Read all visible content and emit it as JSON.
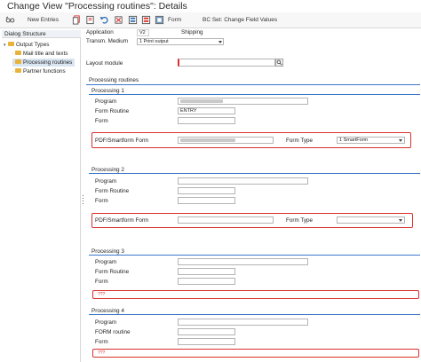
{
  "window": {
    "title": "Change View \"Processing routines\": Details"
  },
  "toolbar": {
    "new_entries": "New Entries",
    "form": "Form",
    "bc_set": "BC Set: Change Field Values"
  },
  "dialog_structure": {
    "title": "Dialog Structure",
    "items": [
      {
        "label": "Output Types"
      },
      {
        "label": "Mail title and texts"
      },
      {
        "label": "Processing routines"
      },
      {
        "label": "Partner functions"
      }
    ]
  },
  "header": {
    "application_label": "Application",
    "application_value": "V2",
    "application_desc": "Shipping",
    "medium_label": "Transm. Medium",
    "medium_value": "1 Print output"
  },
  "layout_module": {
    "label": "Layout module"
  },
  "routines_title": "Processing routines",
  "proc1": {
    "title": "Processing 1",
    "program_label": "Program",
    "form_routine_label": "Form Routine",
    "form_routine_value": "ENTRY",
    "form_label": "Form",
    "pdf_label": "PDF/Smartform Form",
    "form_type_label": "Form Type",
    "form_type_value": "1 SmartForm"
  },
  "proc2": {
    "title": "Processing 2",
    "program_label": "Program",
    "form_routine_label": "Form Routine",
    "form_label": "Form",
    "pdf_label": "PDF/Smartform Form",
    "form_type_label": "Form Type"
  },
  "proc3": {
    "title": "Processing 3",
    "program_label": "Program",
    "form_routine_label": "Form Routine",
    "form_label": "Form",
    "missing": "???"
  },
  "proc4": {
    "title": "Processing 4",
    "program_label": "Program",
    "form_routine_label": "FORM routine",
    "form_label": "Form",
    "missing": "???"
  },
  "colors": {
    "accent_rule": "#3a78c9",
    "highlight": "#d9302c",
    "folder": "#e8b33a"
  },
  "icons": [
    "glasses-icon",
    "copy-icon",
    "copy-as-icon",
    "undo-icon",
    "delete-icon",
    "select-all-icon",
    "deselect-all-icon",
    "block-select-icon",
    "search-help-icon",
    "folder-icon"
  ]
}
